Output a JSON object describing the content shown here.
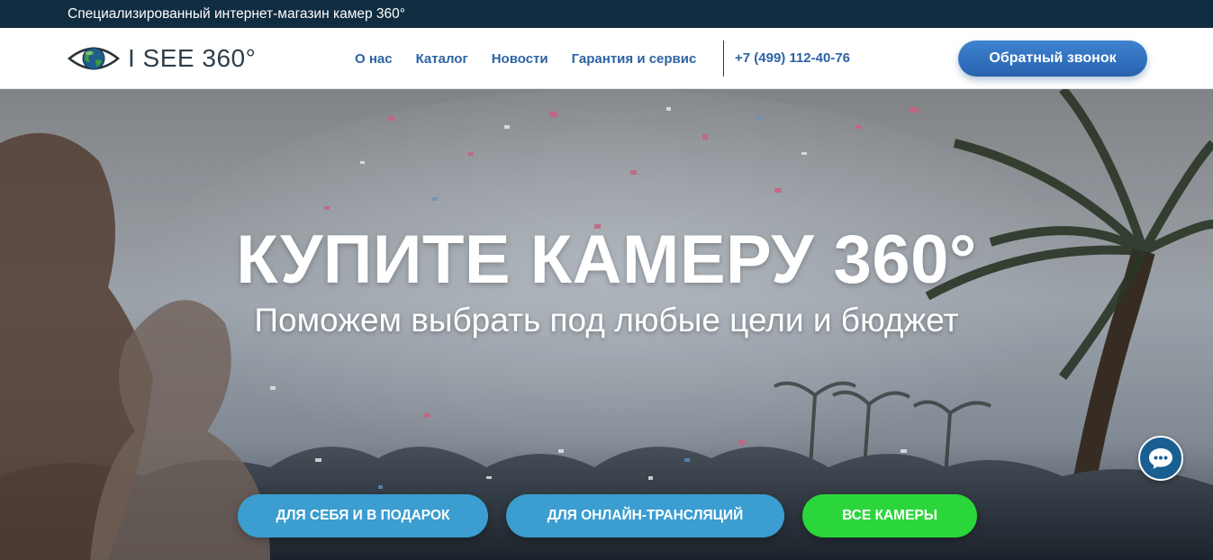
{
  "topbar": {
    "tagline": "Специализированный интернет-магазин камер 360°"
  },
  "header": {
    "logo_text": "I SEE 360°",
    "nav": [
      {
        "label": "О нас"
      },
      {
        "label": "Каталог"
      },
      {
        "label": "Новости"
      },
      {
        "label": "Гарантия и сервис"
      }
    ],
    "phone": "+7 (499) 112-40-76",
    "callback_label": "Обратный звонок"
  },
  "hero": {
    "title": "КУПИТЕ КАМЕРУ 360°",
    "subtitle": "Поможем выбрать под любые цели и бюджет",
    "buttons": [
      {
        "label": "ДЛЯ СЕБЯ И В ПОДАРОК"
      },
      {
        "label": "ДЛЯ ОНЛАЙН-ТРАНСЛЯЦИЙ"
      },
      {
        "label": "ВСЕ КАМЕРЫ"
      }
    ]
  },
  "chat_widget": {
    "icon": "chat-icon"
  },
  "colors": {
    "topbar_bg": "#102c40",
    "nav_link": "#2c63a4",
    "callback_button": "#2e6ebd",
    "cta_blue": "#3b9dd0",
    "cta_green": "#2bd63a",
    "chat_widget": "#1a5f92"
  }
}
